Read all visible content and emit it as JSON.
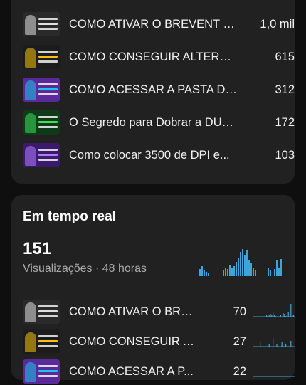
{
  "top_videos": [
    {
      "title": "COMO ATIVAR O BREVENT E...",
      "value": "1,0 mil",
      "thumb_color": "#2a2a2a",
      "accent": "#e0e0e0"
    },
    {
      "title": "COMO CONSEGUIR ALTERAR...",
      "value": "615",
      "thumb_color": "#1c1c1c",
      "accent": "#f4c20d"
    },
    {
      "title": "COMO ACESSAR A PASTA DA...",
      "value": "312",
      "thumb_color": "#5a2a9a",
      "accent": "#19c4e8"
    },
    {
      "title": "O Segredo para Dobrar a DUR...",
      "value": "172",
      "thumb_color": "#0f3a1a",
      "accent": "#3ee05a"
    },
    {
      "title": "Como colocar 3500 de DPI e...",
      "value": "103",
      "thumb_color": "#3a1a6a",
      "accent": "#b07cff"
    }
  ],
  "realtime": {
    "heading": "Em tempo real",
    "views": "151",
    "views_label": "Visualizações · 48 horas",
    "bar_color": "#3ea6d6",
    "bars": [
      0.25,
      0.35,
      0.2,
      0.15,
      0.1,
      0,
      0,
      0,
      0,
      0,
      0,
      0.2,
      0.3,
      0.25,
      0.4,
      0.3,
      0.35,
      0.5,
      0.65,
      0.85,
      0.95,
      0.75,
      0.9,
      0.55,
      0.45,
      0.3,
      0.2,
      0,
      0,
      0,
      0,
      0,
      0.3,
      0.2,
      0,
      0.25,
      0.55,
      0.3,
      0.6,
      1.0,
      0.5,
      1.0,
      0.4,
      0.35
    ],
    "videos": [
      {
        "title": "COMO ATIVAR O BRE...",
        "value": "70",
        "thumb_color": "#2a2a2a",
        "accent": "#e0e0e0",
        "spark": [
          0,
          0,
          0,
          0,
          0,
          0,
          0,
          0,
          0,
          0,
          0.1,
          0.05,
          0.15,
          0.2,
          0.1,
          0.3,
          0.15,
          0.05,
          0,
          0,
          0,
          0.1,
          0,
          0.25,
          0.2,
          0.05,
          0.1,
          0.3,
          0,
          0.9,
          0.15,
          0.1
        ]
      },
      {
        "title": "COMO CONSEGUIR A...",
        "value": "27",
        "thumb_color": "#1c1c1c",
        "accent": "#f4c20d",
        "spark": [
          0,
          0,
          0,
          0,
          0,
          0.3,
          0,
          0,
          0,
          0,
          0,
          0,
          0.2,
          0,
          0,
          0.6,
          0,
          0,
          0.15,
          0,
          0,
          0,
          0.3,
          0,
          0,
          0.2,
          0,
          0,
          0,
          0.4,
          0,
          0
        ]
      },
      {
        "title": "COMO ACESSAR A P...",
        "value": "22",
        "thumb_color": "#5a2a9a",
        "accent": "#19c4e8",
        "spark": [
          0,
          0,
          0,
          0,
          0,
          0,
          0,
          0,
          0,
          0,
          0,
          0,
          0,
          0,
          0,
          0,
          0,
          0,
          0,
          0,
          0,
          0,
          0,
          0,
          0,
          0,
          0,
          0,
          0,
          0,
          0,
          0
        ]
      }
    ]
  }
}
